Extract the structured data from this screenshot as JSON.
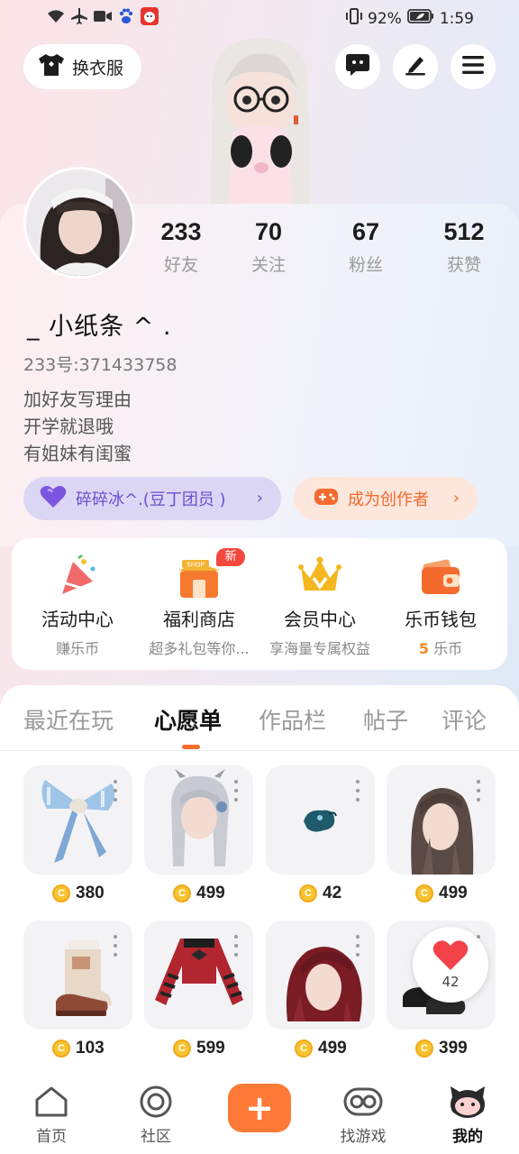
{
  "status_bar": {
    "battery": "92%",
    "time": "1:59",
    "icons": [
      "wifi-icon",
      "airplane-icon",
      "video-icon",
      "baidu-icon",
      "app-notification-icon",
      "vibrate-icon",
      "battery-icon"
    ]
  },
  "header": {
    "outfit_label": "换衣服",
    "icons": [
      "chat-icon",
      "edit-icon",
      "menu-icon"
    ]
  },
  "profile": {
    "stats": [
      {
        "value": "233",
        "label": "好友"
      },
      {
        "value": "70",
        "label": "关注"
      },
      {
        "value": "67",
        "label": "粉丝"
      },
      {
        "value": "512",
        "label": "获赞"
      }
    ],
    "nickname": "_ 小纸条 ^ .",
    "uid": "233号:371433758",
    "bio": [
      "加好友写理由",
      "开学就退哦",
      "有姐妹有闺蜜"
    ],
    "fan_group_label": "碎碎冰^.(豆丁团员 )",
    "creator_label": "成为创作者"
  },
  "quick_entries": [
    {
      "title": "活动中心",
      "subtitle": "赚乐币",
      "icon": "party-horn-icon"
    },
    {
      "title": "福利商店",
      "subtitle": "超多礼包等你...",
      "icon": "shop-icon",
      "badge": "新"
    },
    {
      "title": "会员中心",
      "subtitle": "享海量专属权益",
      "icon": "crown-icon"
    },
    {
      "title": "乐币钱包",
      "subtitle_count": "5",
      "subtitle": "乐币",
      "icon": "wallet-icon"
    }
  ],
  "tabs": [
    {
      "label": "最近在玩",
      "active": false
    },
    {
      "label": "心愿单",
      "active": true
    },
    {
      "label": "作品栏",
      "active": false
    },
    {
      "label": "帖子",
      "active": false
    },
    {
      "label": "评论",
      "active": false
    }
  ],
  "wishlist": [
    {
      "price": "380",
      "item": "bow-accessory"
    },
    {
      "price": "499",
      "item": "silver-twin-tail-hair"
    },
    {
      "price": "42",
      "item": "teal-ornament"
    },
    {
      "price": "499",
      "item": "long-brown-hair"
    },
    {
      "price": "103",
      "item": "brown-boots"
    },
    {
      "price": "599",
      "item": "striped-crop-top"
    },
    {
      "price": "499",
      "item": "dark-red-hair"
    },
    {
      "price": "399",
      "item": "black-shoes"
    }
  ],
  "like_float": {
    "count": "42"
  },
  "bottom_nav": [
    {
      "label": "首页",
      "icon": "home-icon",
      "active": false
    },
    {
      "label": "社区",
      "icon": "community-icon",
      "active": false
    },
    {
      "label": "找游戏",
      "icon": "find-game-icon",
      "active": false
    },
    {
      "label": "我的",
      "icon": "profile-mascot-icon",
      "active": true
    }
  ],
  "colors": {
    "accent": "#f56a2d",
    "fan_pill_bg": "#dcd6f5",
    "fan_pill_text": "#6a4fd0",
    "creator_pill_bg": "#fde6dc",
    "creator_pill_text": "#f06a2e",
    "coin": "#f7c331",
    "badge_red": "#f4483f"
  }
}
